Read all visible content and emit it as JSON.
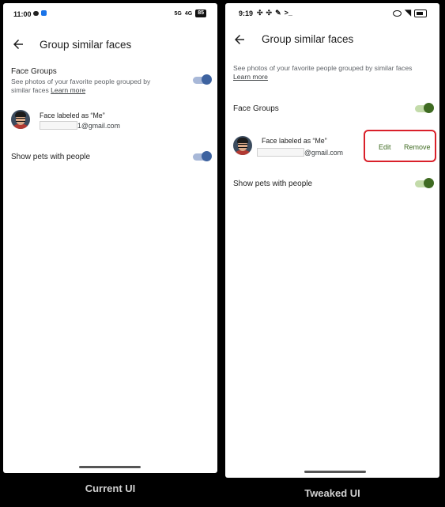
{
  "left": {
    "status_time": "11:00",
    "status_net": "5G",
    "status_signal": "4G",
    "battery": "85",
    "title": "Group similar faces",
    "face_groups_title": "Face Groups",
    "face_groups_desc": "See photos of your favorite people grouped by similar faces",
    "learn_more": "Learn more",
    "face_label": "Face labeled as “Me”",
    "email_suffix": "1@gmail.com",
    "pets_title": "Show pets with people",
    "caption": "Current UI",
    "toggles": {
      "face_groups_on": true,
      "pets_on": true,
      "accent": "#3e63a0"
    }
  },
  "right": {
    "status_time": "9:19",
    "status_extra": ">_",
    "title": "Group similar faces",
    "desc": "See photos of your favorite people grouped by similar faces",
    "learn_more": "Learn more",
    "face_groups_title": "Face Groups",
    "face_label": "Face labeled as “Me”",
    "email_suffix": "@gmail.com",
    "edit_label": "Edit",
    "remove_label": "Remove",
    "pets_title": "Show pets with people",
    "caption": "Tweaked UI",
    "toggles": {
      "face_groups_on": true,
      "pets_on": true,
      "accent": "#3f6b22"
    },
    "highlight_color": "#d9202a"
  }
}
